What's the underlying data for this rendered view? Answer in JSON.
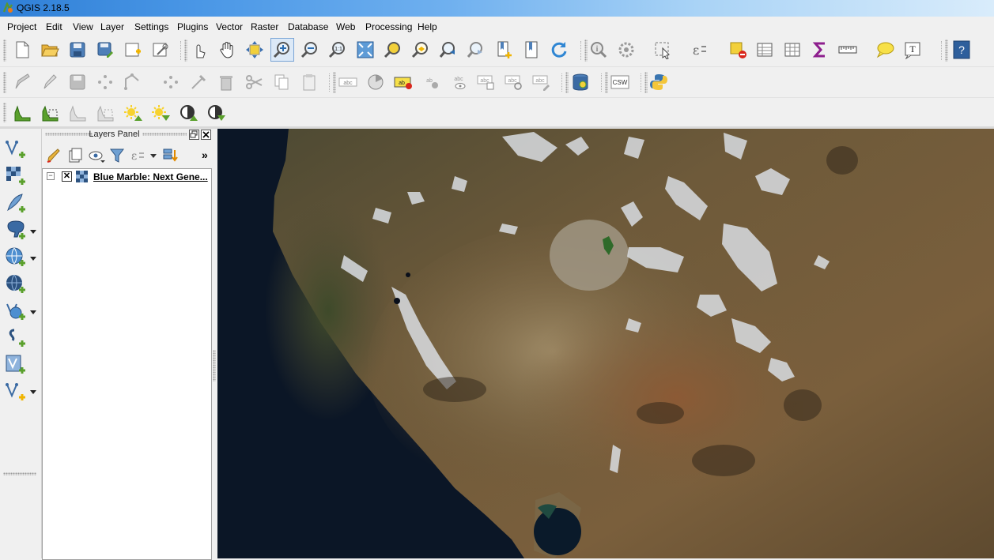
{
  "window": {
    "title": "QGIS 2.18.5"
  },
  "menubar": {
    "items": [
      "Project",
      "Edit",
      "View",
      "Layer",
      "Settings",
      "Plugins",
      "Vector",
      "Raster",
      "Database",
      "Web",
      "Processing",
      "Help"
    ]
  },
  "toolbar_text": {
    "scale_label": "1:1",
    "csw_label": "CSW",
    "text_annotation": "T"
  },
  "label_toolbar": {
    "abc_tokens": [
      "abc",
      "ab",
      "ab",
      "abc",
      "abc",
      "abc",
      "abc"
    ]
  },
  "layers_panel": {
    "title": "Layers Panel",
    "more_label": "»",
    "layers": [
      {
        "name": "Blue Marble: Next Gene...",
        "visible": true,
        "expanded": true,
        "type": "raster"
      }
    ]
  },
  "map_canvas": {
    "layer": "Blue Marble: Next Generation imagery (western United States)"
  },
  "colors": {
    "titlebar_accent": "#2f7fd6",
    "toolbar_bg": "#f0f0f0",
    "map_ocean": "#0b1626",
    "map_land": "#6b5636"
  },
  "icons": {
    "row1": [
      "new-project-icon",
      "open-project-icon",
      "save-project-icon",
      "save-as-icon",
      "new-print-composer-icon",
      "composer-manager-icon",
      "touch-zoom-icon",
      "pan-icon",
      "pan-to-selection-icon",
      "zoom-in-icon",
      "zoom-out-icon",
      "zoom-native-icon",
      "zoom-full-icon",
      "zoom-to-selection-icon",
      "zoom-to-layer-icon",
      "zoom-last-icon",
      "zoom-next-icon",
      "new-bookmark-icon",
      "show-bookmarks-icon",
      "refresh-icon",
      "identify-icon",
      "action-icon",
      "select-icon",
      "expression-select-icon",
      "deselect-icon",
      "attribute-table-icon",
      "field-calculator-icon",
      "statistics-icon",
      "measure-icon",
      "map-tips-icon",
      "text-annotation-icon",
      "help-icon"
    ],
    "row2": [
      "current-edits-icon",
      "toggle-editing-icon",
      "save-edits-icon",
      "add-feature-icon",
      "move-feature-icon",
      "node-tool-icon",
      "delete-selected-icon",
      "cut-features-icon",
      "copy-features-icon",
      "paste-features-icon",
      "label-toolbar-icons",
      "db-manager-icon",
      "csw-icon",
      "python-console-icon"
    ],
    "row3": [
      "histogram-stretch-icon",
      "local-histogram-stretch-icon",
      "full-histogram-icon",
      "local-cumulative-cut-icon",
      "increase-brightness-icon",
      "decrease-brightness-icon",
      "increase-contrast-icon",
      "decrease-contrast-icon"
    ],
    "left": [
      "add-vector-layer-icon",
      "add-raster-layer-icon",
      "add-spatialite-layer-icon",
      "add-postgis-layer-icon",
      "add-wms-layer-icon",
      "add-wcs-layer-icon",
      "add-wfs-layer-icon",
      "add-delimited-text-icon",
      "add-virtual-layer-icon",
      "new-shapefile-icon"
    ]
  }
}
